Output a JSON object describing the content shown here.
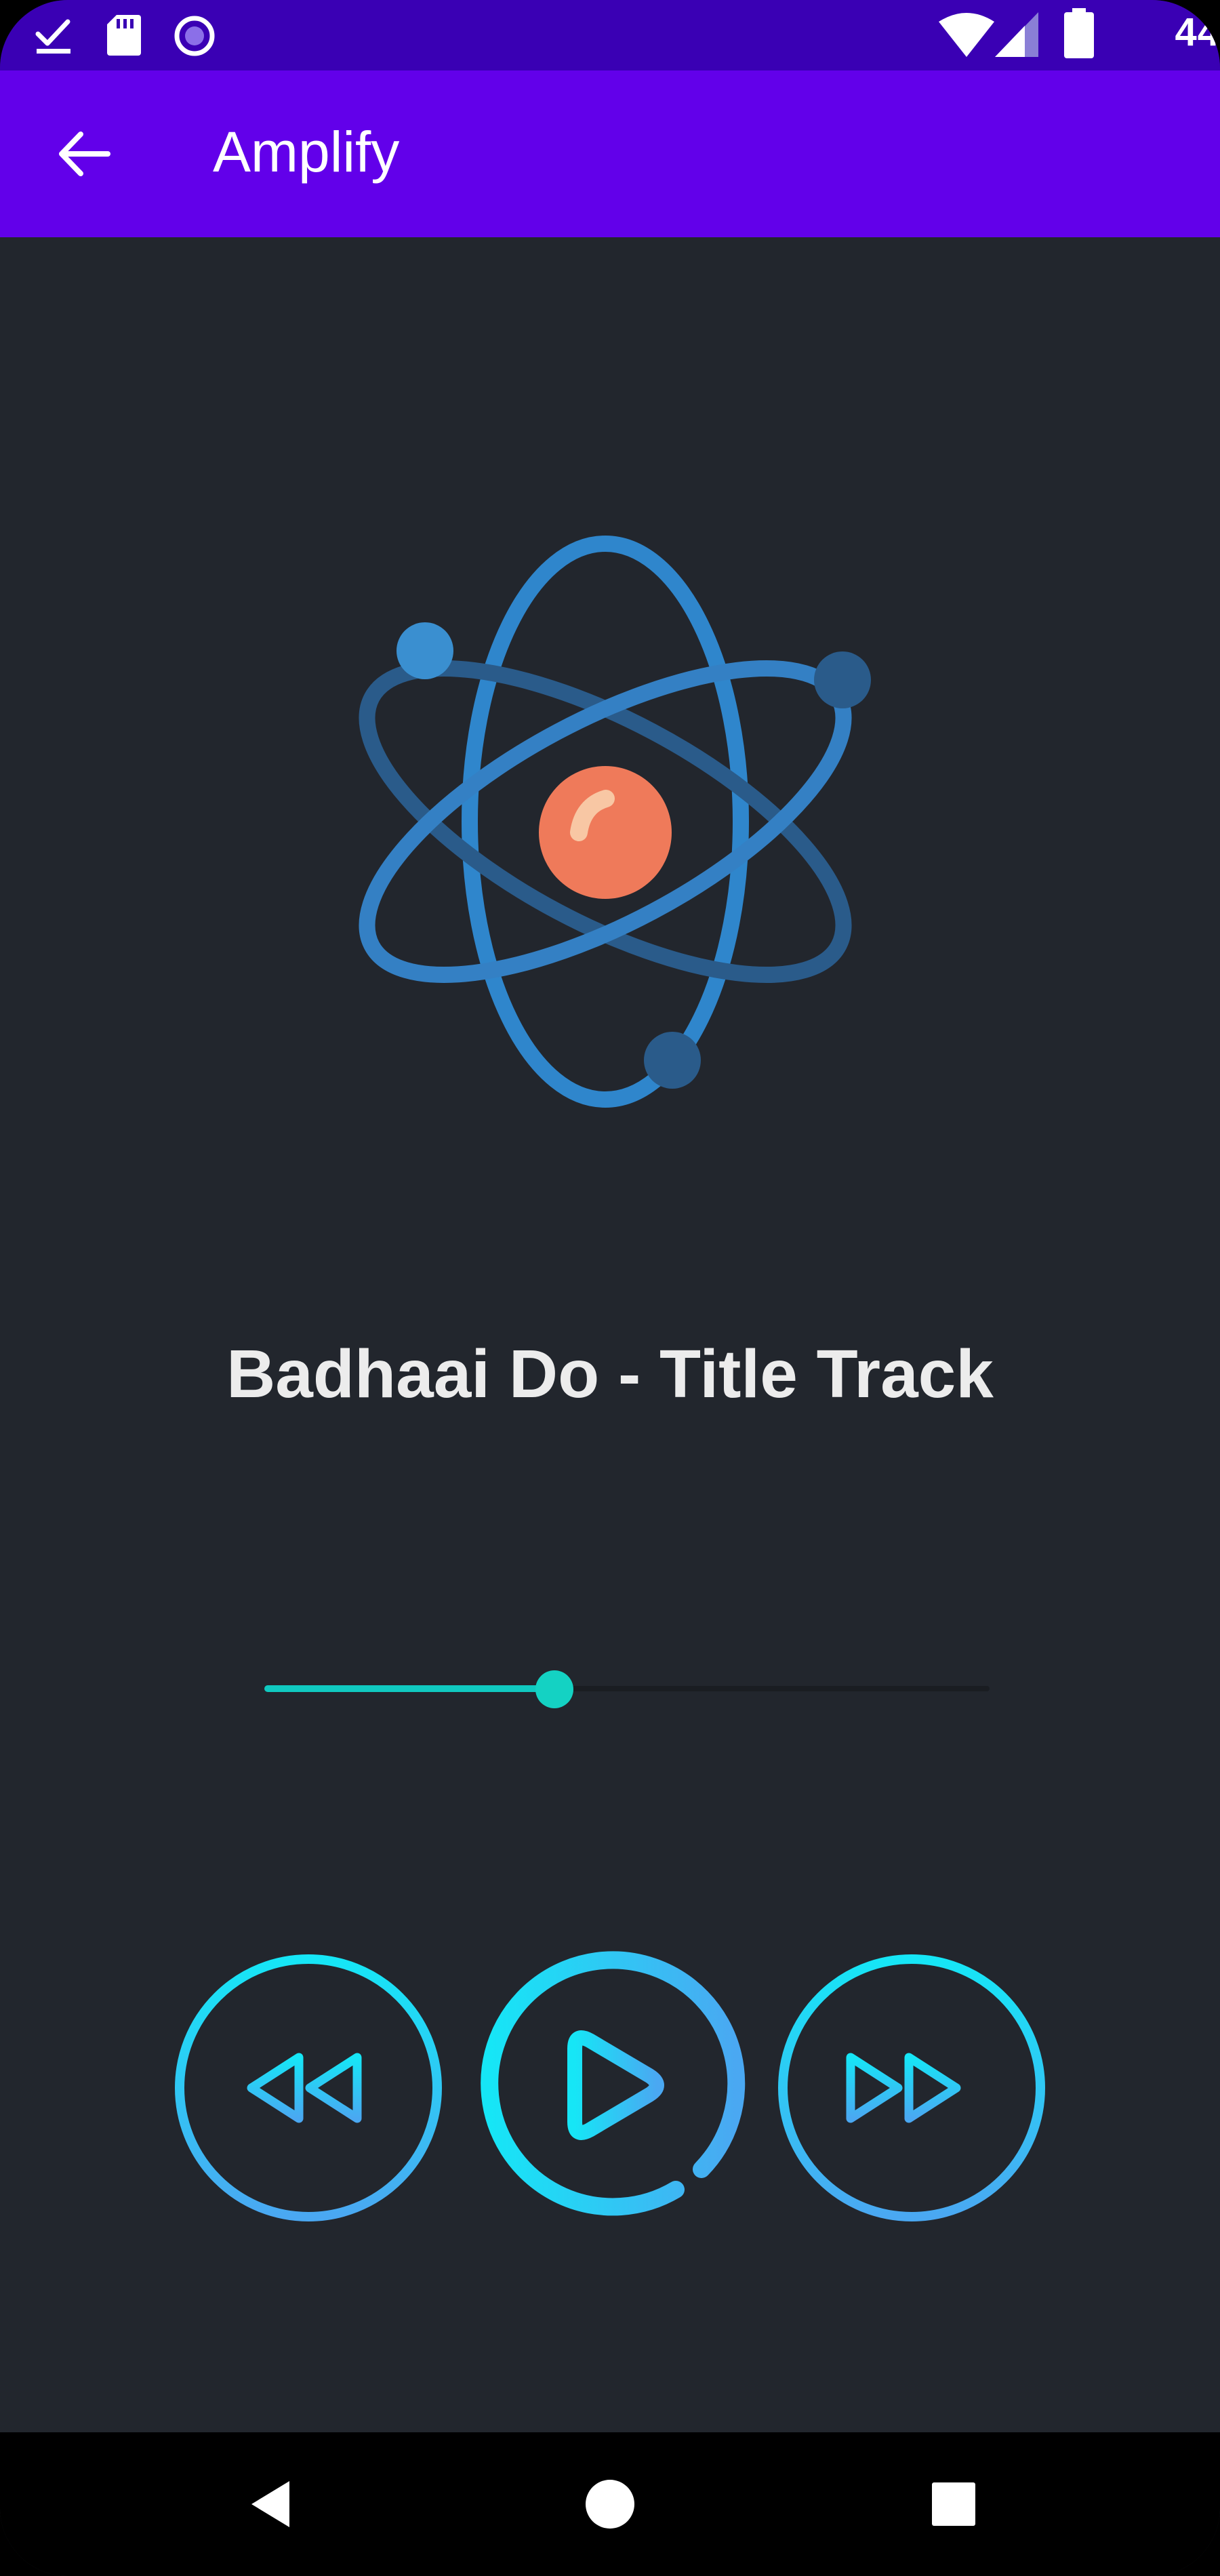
{
  "status_bar": {
    "time": "44",
    "icons": [
      "download-done-icon",
      "sd-card-icon",
      "record-icon",
      "wifi-icon",
      "signal-icon",
      "battery-icon"
    ]
  },
  "app_bar": {
    "title": "Amplify",
    "back_icon": "arrow-back-icon"
  },
  "artwork": {
    "icon": "atom-icon"
  },
  "player": {
    "track_title": "Badhaai Do - Title Track",
    "progress": 0.4
  },
  "controls": {
    "previous_icon": "skip-previous-icon",
    "play_icon": "play-icon",
    "next_icon": "skip-next-icon"
  },
  "nav_bar": {
    "back_icon": "nav-back-icon",
    "home_icon": "nav-home-icon",
    "recents_icon": "nav-recents-icon"
  },
  "colors": {
    "status_bar": "#3a00b4",
    "app_bar": "#6200ea",
    "background": "#22262d",
    "accent_teal": "#14d2c3",
    "control_cyan": "#16e6f6",
    "control_blue": "#4aa8f2",
    "atom_orbit_light": "#3a8fd0",
    "atom_orbit_dark": "#2a5b8a",
    "nucleus": "#ef7a5a"
  }
}
